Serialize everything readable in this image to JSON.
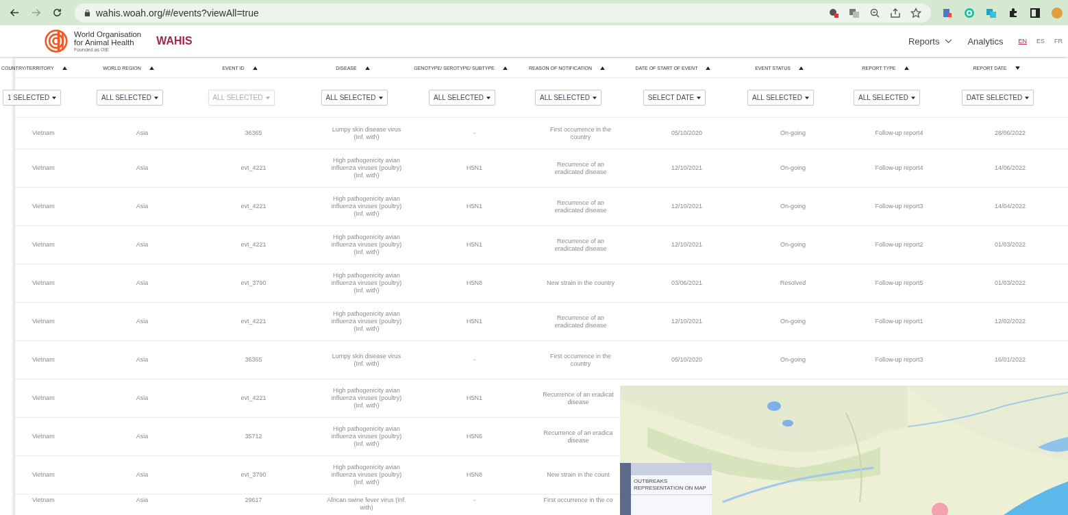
{
  "browser": {
    "url": "wahis.woah.org/#/events?viewAll=true"
  },
  "header": {
    "org_lines": [
      "World Organisation",
      "for Animal Health"
    ],
    "tagline": "Founded as OIE",
    "app_name": "WAHIS",
    "nav": [
      {
        "label": "Reports",
        "kind": "dropdown"
      },
      {
        "label": "Analytics",
        "kind": "link"
      }
    ],
    "languages": [
      {
        "label": "EN",
        "selected": true
      },
      {
        "label": "ES",
        "selected": false
      },
      {
        "label": "FR",
        "selected": false
      }
    ]
  },
  "table": {
    "columns": [
      {
        "label": "COUNTRY/TERRITORY",
        "descending": false,
        "filter": {
          "label": "1 SELECTED",
          "disabled": false
        }
      },
      {
        "label": "WORLD REGION",
        "descending": false,
        "filter": {
          "label": "ALL SELECTED",
          "disabled": false
        }
      },
      {
        "label": "EVENT ID",
        "descending": false,
        "filter": {
          "label": "ALL SELECTED",
          "disabled": true
        }
      },
      {
        "label": "DISEASE",
        "descending": false,
        "filter": {
          "label": "ALL SELECTED",
          "disabled": false
        }
      },
      {
        "label": "GENOTYPE/ SEROTYPE/ SUBTYPE",
        "descending": false,
        "filter": {
          "label": "ALL SELECTED",
          "disabled": false
        }
      },
      {
        "label": "REASON OF NOTIFICATION",
        "descending": false,
        "filter": {
          "label": "ALL SELECTED",
          "disabled": false
        }
      },
      {
        "label": "DATE OF START OF EVENT",
        "descending": false,
        "filter": {
          "label": "SELECT DATE",
          "disabled": false
        }
      },
      {
        "label": "EVENT STATUS",
        "descending": false,
        "filter": {
          "label": "ALL SELECTED",
          "disabled": false
        }
      },
      {
        "label": "REPORT TYPE",
        "descending": false,
        "filter": {
          "label": "ALL SELECTED",
          "disabled": false
        }
      },
      {
        "label": "REPORT DATE",
        "descending": true,
        "filter": {
          "label": "DATE SELECTED",
          "disabled": false
        }
      }
    ],
    "rows": [
      {
        "cells": [
          "Vietnam",
          "Asia",
          "36365",
          "Lumpy skin disease virus (Inf. with)",
          "-",
          "First occurrence in the country",
          "05/10/2020",
          "On-going",
          "Follow-up report4",
          "28/06/2022"
        ]
      },
      {
        "cells": [
          "Vietnam",
          "Asia",
          "evt_4221",
          "High pathogenicity avian influenza viruses (poultry) (Inf. with)",
          "H5N1",
          "Recurrence of an eradicated disease",
          "12/10/2021",
          "On-going",
          "Follow-up report4",
          "14/06/2022"
        ]
      },
      {
        "cells": [
          "Vietnam",
          "Asia",
          "evt_4221",
          "High pathogenicity avian influenza viruses (poultry) (Inf. with)",
          "H5N1",
          "Recurrence of an eradicated disease",
          "12/10/2021",
          "On-going",
          "Follow-up report3",
          "14/04/2022"
        ]
      },
      {
        "cells": [
          "Vietnam",
          "Asia",
          "evt_4221",
          "High pathogenicity avian influenza viruses (poultry) (Inf. with)",
          "H5N1",
          "Recurrence of an eradicated disease",
          "12/10/2021",
          "On-going",
          "Follow-up report2",
          "01/03/2022"
        ]
      },
      {
        "cells": [
          "Vietnam",
          "Asia",
          "evt_3790",
          "High pathogenicity avian influenza viruses (poultry) (Inf. with)",
          "H5N8",
          "New strain in the country",
          "03/06/2021",
          "Resolved",
          "Follow-up report5",
          "01/03/2022"
        ]
      },
      {
        "cells": [
          "Vietnam",
          "Asia",
          "evt_4221",
          "High pathogenicity avian influenza viruses (poultry) (Inf. with)",
          "H5N1",
          "Recurrence of an eradicated disease",
          "12/10/2021",
          "On-going",
          "Follow-up report1",
          "12/02/2022"
        ]
      },
      {
        "cells": [
          "Vietnam",
          "Asia",
          "36365",
          "Lumpy skin disease virus (Inf. with)",
          "-",
          "First occurrence in the country",
          "05/10/2020",
          "On-going",
          "Follow-up report3",
          "16/01/2022"
        ]
      },
      {
        "cells": [
          "Vietnam",
          "Asia",
          "evt_4221",
          "High pathogenicity avian influenza viruses (poultry) (Inf. with)",
          "H5N1",
          "Recurrence of an eradicat disease"
        ]
      },
      {
        "cells": [
          "Vietnam",
          "Asia",
          "35712",
          "High pathogenicity avian influenza viruses (poultry) (Inf. with)",
          "H5N6",
          "Recurrence of an eradica disease"
        ]
      },
      {
        "cells": [
          "Vietnam",
          "Asia",
          "evt_3790",
          "High pathogenicity avian influenza viruses (poultry) (Inf. with)",
          "H5N8",
          "New strain in the count"
        ]
      },
      {
        "cells": [
          "Vietnam",
          "Asia",
          "29617",
          "African swine fever virus (Inf. with)",
          "-",
          "First occurrence in the co"
        ]
      }
    ]
  },
  "map_inset": {
    "panel_title": "OUTBREAKS REPRESENTATION ON MAP"
  }
}
